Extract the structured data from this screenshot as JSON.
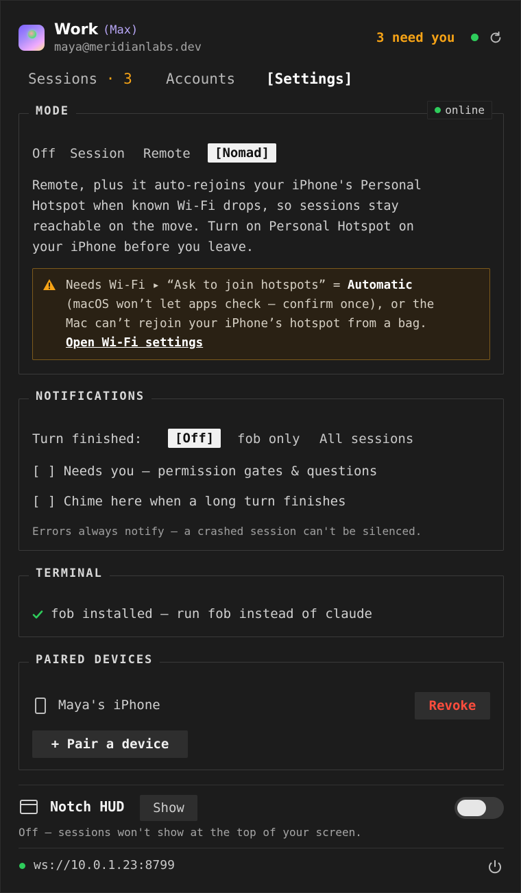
{
  "header": {
    "account_name": "Work",
    "plan": "(Max)",
    "email": "maya@meridianlabs.dev",
    "attention_text": "3 need you",
    "status_color": "#2ecc5b",
    "accent_color": "#f6a316",
    "refresh_icon": "refresh-icon"
  },
  "tabs": {
    "sessions": "Sessions",
    "sessions_sep": " · ",
    "sessions_count": "3",
    "accounts": "Accounts",
    "settings": "[Settings]"
  },
  "mode": {
    "legend": "MODE",
    "online": "online",
    "options": [
      "Off",
      "Session",
      "Remote",
      "[Nomad]"
    ],
    "selected": "Nomad",
    "description": [
      "Remote, plus it auto-rejoins your iPhone's Personal",
      "Hotspot when known Wi-Fi drops, so sessions stay",
      "reachable on the move. Turn on Personal Hotspot on",
      "your iPhone before you leave."
    ],
    "warning_line1_pre": "Needs Wi-Fi ▸ “Ask to join hotspots” = ",
    "warning_line1_bold": "Automatic",
    "warning_line2": "(macOS won’t let apps check — confirm once), or the",
    "warning_line3": "Mac can’t rejoin your iPhone’s hotspot from a bag.",
    "warning_link": "Open Wi-Fi settings"
  },
  "notifications": {
    "legend": "NOTIFICATIONS",
    "turn_label": "Turn finished:",
    "options": [
      "[Off]",
      "fob only",
      "All sessions"
    ],
    "selected": "Off",
    "check1": "[ ] Needs you — permission gates & questions",
    "check2": "[ ] Chime here when a long turn finishes",
    "note": "Errors always notify — a crashed session can't be silenced."
  },
  "terminal": {
    "legend": "TERMINAL",
    "status": "fob installed — run fob instead of claude"
  },
  "paired": {
    "legend": "PAIRED DEVICES",
    "device": "Maya's iPhone",
    "revoke": "Revoke",
    "pair": "+ Pair a device"
  },
  "hud": {
    "label": "Notch HUD",
    "show": "Show",
    "toggle_on": false,
    "note": "Off — sessions won't show at the top of your screen."
  },
  "footer": {
    "ws_url": "ws://10.0.1.23:8799"
  }
}
